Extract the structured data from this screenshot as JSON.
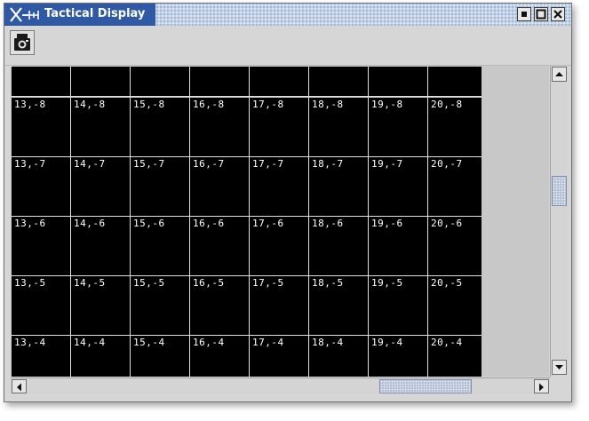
{
  "window": {
    "title": "Tactical Display",
    "controls": [
      "minimize",
      "maximize",
      "close"
    ]
  },
  "toolbar": {
    "buttons": [
      {
        "name": "snapshot",
        "icon": "camera-icon"
      }
    ]
  },
  "grid": {
    "columns": [
      13,
      14,
      15,
      16,
      17,
      18,
      19,
      20
    ],
    "rows": [
      [
        "13,-8",
        "14,-8",
        "15,-8",
        "16,-8",
        "17,-8",
        "18,-8",
        "19,-8",
        "20,-8"
      ],
      [
        "13,-7",
        "14,-7",
        "15,-7",
        "16,-7",
        "17,-7",
        "18,-7",
        "19,-7",
        "20,-7"
      ],
      [
        "13,-6",
        "14,-6",
        "15,-6",
        "16,-6",
        "17,-6",
        "18,-6",
        "19,-6",
        "20,-6"
      ],
      [
        "13,-5",
        "14,-5",
        "15,-5",
        "16,-5",
        "17,-5",
        "18,-5",
        "19,-5",
        "20,-5"
      ],
      [
        "13,-4",
        "14,-4",
        "15,-4",
        "16,-4",
        "17,-4",
        "18,-4",
        "19,-4",
        "20,-4"
      ]
    ]
  },
  "scrollbars": {
    "vertical": {
      "position_fraction": 0.38
    },
    "horizontal": {
      "position_fraction": 0.85
    }
  },
  "colors": {
    "title_bar": "#2f59a4",
    "cell_background": "#000000",
    "cell_text": "#ffffff",
    "grid_lines": "#e0e0e0"
  }
}
